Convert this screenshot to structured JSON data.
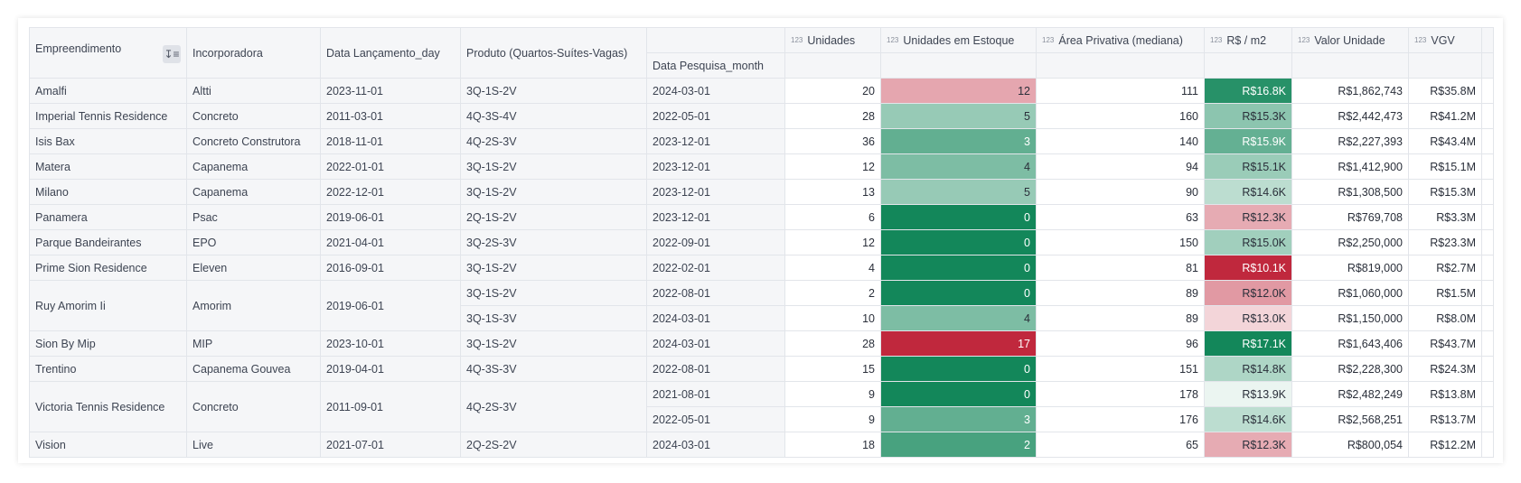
{
  "headers": {
    "empreendimento": "Empreendimento",
    "incorporadora": "Incorporadora",
    "data_lancamento": "Data Lançamento_day",
    "produto": "Produto (Quartos-Suítes-Vagas)",
    "data_pesquisa": "Data Pesquisa_month",
    "unidades": "Unidades",
    "estoque": "Unidades em Estoque",
    "area": "Área Privativa (mediana)",
    "rs_m2": "R$ / m2",
    "valor_unidade": "Valor Unidade",
    "vgv": "VGV",
    "numeric_type_icon": "123"
  },
  "icons": {
    "sort": "sort-ascending-icon"
  },
  "scales": {
    "estoque": {
      "min_color": "#13875a",
      "mid_color": "#ffffff",
      "max_color": "#c0283d",
      "min": 0,
      "max": 17
    },
    "rs_m2": {
      "low_color": "#c0283d",
      "mid_color": "#ffffff",
      "high_color": "#13875a",
      "low": 10100,
      "mid": 13600,
      "high": 17100
    }
  },
  "rows": [
    {
      "empreendimento": "Amalfi",
      "incorporadora": "Altti",
      "data_lancamento": "2023-11-01",
      "produto": "3Q-1S-2V",
      "data_pesquisa": "2024-03-01",
      "unidades": "20",
      "estoque": "12",
      "area": "111",
      "rs_m2": "R$16.8K",
      "valor_unidade": "R$1,862,743",
      "vgv": "R$35.8M",
      "estoque_n": 12,
      "rs_m2_n": 16800
    },
    {
      "empreendimento": "Imperial Tennis Residence",
      "incorporadora": "Concreto",
      "data_lancamento": "2011-03-01",
      "produto": "4Q-3S-4V",
      "data_pesquisa": "2022-05-01",
      "unidades": "28",
      "estoque": "5",
      "area": "160",
      "rs_m2": "R$15.3K",
      "valor_unidade": "R$2,442,473",
      "vgv": "R$41.2M",
      "estoque_n": 5,
      "rs_m2_n": 15300
    },
    {
      "empreendimento": "Isis Bax",
      "incorporadora": "Concreto Construtora",
      "data_lancamento": "2018-11-01",
      "produto": "4Q-2S-3V",
      "data_pesquisa": "2023-12-01",
      "unidades": "36",
      "estoque": "3",
      "area": "140",
      "rs_m2": "R$15.9K",
      "valor_unidade": "R$2,227,393",
      "vgv": "R$43.4M",
      "estoque_n": 3,
      "rs_m2_n": 15900
    },
    {
      "empreendimento": "Matera",
      "incorporadora": "Capanema",
      "data_lancamento": "2022-01-01",
      "produto": "3Q-1S-2V",
      "data_pesquisa": "2023-12-01",
      "unidades": "12",
      "estoque": "4",
      "area": "94",
      "rs_m2": "R$15.1K",
      "valor_unidade": "R$1,412,900",
      "vgv": "R$15.1M",
      "estoque_n": 4,
      "rs_m2_n": 15100
    },
    {
      "empreendimento": "Milano",
      "incorporadora": "Capanema",
      "data_lancamento": "2022-12-01",
      "produto": "3Q-1S-2V",
      "data_pesquisa": "2023-12-01",
      "unidades": "13",
      "estoque": "5",
      "area": "90",
      "rs_m2": "R$14.6K",
      "valor_unidade": "R$1,308,500",
      "vgv": "R$15.3M",
      "estoque_n": 5,
      "rs_m2_n": 14600
    },
    {
      "empreendimento": "Panamera",
      "incorporadora": "Psac",
      "data_lancamento": "2019-06-01",
      "produto": "2Q-1S-2V",
      "data_pesquisa": "2023-12-01",
      "unidades": "6",
      "estoque": "0",
      "area": "63",
      "rs_m2": "R$12.3K",
      "valor_unidade": "R$769,708",
      "vgv": "R$3.3M",
      "estoque_n": 0,
      "rs_m2_n": 12300
    },
    {
      "empreendimento": "Parque Bandeirantes",
      "incorporadora": "EPO",
      "data_lancamento": "2021-04-01",
      "produto": "3Q-2S-3V",
      "data_pesquisa": "2022-09-01",
      "unidades": "12",
      "estoque": "0",
      "area": "150",
      "rs_m2": "R$15.0K",
      "valor_unidade": "R$2,250,000",
      "vgv": "R$23.3M",
      "estoque_n": 0,
      "rs_m2_n": 15000
    },
    {
      "empreendimento": "Prime Sion Residence",
      "incorporadora": "Eleven",
      "data_lancamento": "2016-09-01",
      "produto": "3Q-1S-2V",
      "data_pesquisa": "2022-02-01",
      "unidades": "4",
      "estoque": "0",
      "area": "81",
      "rs_m2": "R$10.1K",
      "valor_unidade": "R$819,000",
      "vgv": "R$2.7M",
      "estoque_n": 0,
      "rs_m2_n": 10100
    },
    {
      "empreendimento": "Ruy Amorim Ii",
      "incorporadora": "Amorim",
      "data_lancamento": "2019-06-01",
      "produto": "3Q-1S-2V",
      "data_pesquisa": "2022-08-01",
      "unidades": "2",
      "estoque": "0",
      "area": "89",
      "rs_m2": "R$12.0K",
      "valor_unidade": "R$1,060,000",
      "vgv": "R$1.5M",
      "estoque_n": 0,
      "rs_m2_n": 12000,
      "span": 2
    },
    {
      "empreendimento": "",
      "incorporadora": "",
      "data_lancamento": "",
      "produto": "3Q-1S-3V",
      "data_pesquisa": "2024-03-01",
      "unidades": "10",
      "estoque": "4",
      "area": "89",
      "rs_m2": "R$13.0K",
      "valor_unidade": "R$1,150,000",
      "vgv": "R$8.0M",
      "estoque_n": 4,
      "rs_m2_n": 13000,
      "cont": true
    },
    {
      "empreendimento": "Sion By Mip",
      "incorporadora": "MIP",
      "data_lancamento": "2023-10-01",
      "produto": "3Q-1S-2V",
      "data_pesquisa": "2024-03-01",
      "unidades": "28",
      "estoque": "17",
      "area": "96",
      "rs_m2": "R$17.1K",
      "valor_unidade": "R$1,643,406",
      "vgv": "R$43.7M",
      "estoque_n": 17,
      "rs_m2_n": 17100
    },
    {
      "empreendimento": "Trentino",
      "incorporadora": "Capanema Gouvea",
      "data_lancamento": "2019-04-01",
      "produto": "4Q-3S-3V",
      "data_pesquisa": "2022-08-01",
      "unidades": "15",
      "estoque": "0",
      "area": "151",
      "rs_m2": "R$14.8K",
      "valor_unidade": "R$2,228,300",
      "vgv": "R$24.3M",
      "estoque_n": 0,
      "rs_m2_n": 14800
    },
    {
      "empreendimento": "Victoria Tennis Residence",
      "incorporadora": "Concreto",
      "data_lancamento": "2011-09-01",
      "produto": "4Q-2S-3V",
      "data_pesquisa": "2021-08-01",
      "unidades": "9",
      "estoque": "0",
      "area": "178",
      "rs_m2": "R$13.9K",
      "valor_unidade": "R$2,482,249",
      "vgv": "R$13.8M",
      "estoque_n": 0,
      "rs_m2_n": 13900,
      "span": 2
    },
    {
      "empreendimento": "",
      "incorporadora": "",
      "data_lancamento": "",
      "produto": "",
      "data_pesquisa": "2022-05-01",
      "unidades": "9",
      "estoque": "3",
      "area": "176",
      "rs_m2": "R$14.6K",
      "valor_unidade": "R$2,568,251",
      "vgv": "R$13.7M",
      "estoque_n": 3,
      "rs_m2_n": 14600,
      "cont": true,
      "prodSpanCont": true
    },
    {
      "empreendimento": "Vision",
      "incorporadora": "Live",
      "data_lancamento": "2021-07-01",
      "produto": "2Q-2S-2V",
      "data_pesquisa": "2024-03-01",
      "unidades": "18",
      "estoque": "2",
      "area": "65",
      "rs_m2": "R$12.3K",
      "valor_unidade": "R$800,054",
      "vgv": "R$12.2M",
      "estoque_n": 2,
      "rs_m2_n": 12300
    }
  ]
}
